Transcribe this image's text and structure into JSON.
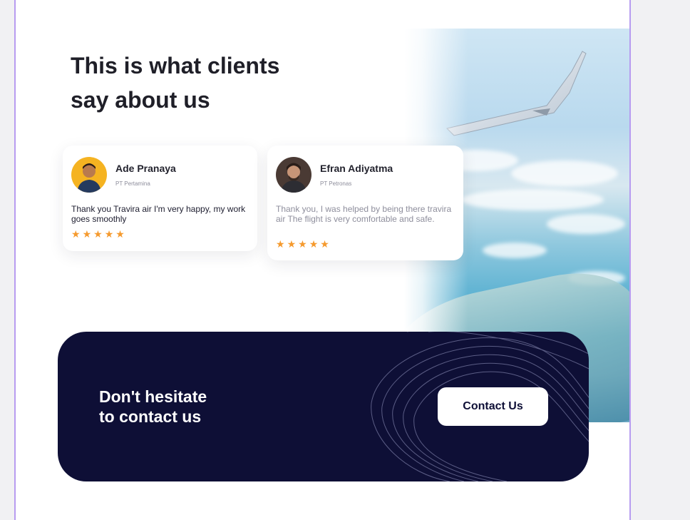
{
  "section": {
    "heading_line1": "This is what clients",
    "heading_line2": "say about us"
  },
  "testimonials": [
    {
      "name": "Ade Pranaya",
      "company": "PT Pertamina",
      "quote": "Thank you Travira air I'm very happy, my work goes smoothly",
      "rating": 5
    },
    {
      "name": "Efran Adiyatma",
      "company": "PT Petronas",
      "quote": "Thank you, I was helped by being there travira air The flight is very comfortable and safe.",
      "rating": 5
    }
  ],
  "cta": {
    "line1": "Don't hesitate",
    "line2": "to contact us",
    "button_label": "Contact Us"
  },
  "colors": {
    "accent_navy": "#0e0f36",
    "star": "#f59a2e",
    "frame_border": "#b79cf0"
  },
  "icons": [
    "star-icon",
    "avatar-photo",
    "airplane-wing-photo"
  ]
}
